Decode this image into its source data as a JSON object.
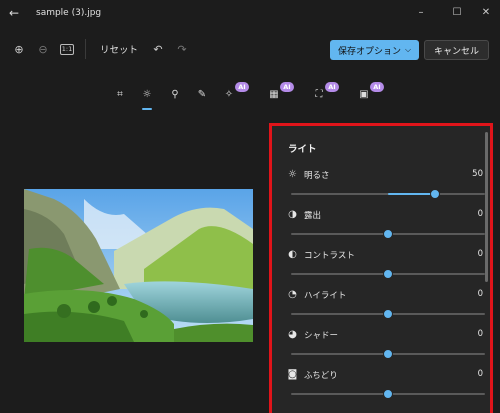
{
  "window": {
    "title": "sample (3).jpg",
    "back_icon": "←",
    "minimize_icon": "–",
    "maximize_icon": "☐",
    "close_icon": "✕"
  },
  "toolbar": {
    "zoom_in_icon": "⊕",
    "zoom_out_icon": "⊖",
    "actual_size_icon": "1:1",
    "reset_label": "リセット",
    "undo_icon": "↶",
    "redo_icon": "↷"
  },
  "actions": {
    "save_label": "保存オプション",
    "save_chevron": "⌵",
    "cancel_label": "キャンセル",
    "accent_color": "#62b6f0"
  },
  "tools": {
    "ai_badge": "AI",
    "items": [
      {
        "name": "crop-icon",
        "glyph": "⌗"
      },
      {
        "name": "adjust-icon",
        "glyph": "☼"
      },
      {
        "name": "filter-icon",
        "glyph": "⚲"
      },
      {
        "name": "markup-icon",
        "glyph": "✎"
      },
      {
        "name": "erase-icon",
        "glyph": "✧"
      },
      {
        "name": "blur-background-icon",
        "glyph": "▦"
      },
      {
        "name": "remove-background-icon",
        "glyph": "⛶"
      },
      {
        "name": "replace-background-icon",
        "glyph": "▣"
      }
    ]
  },
  "panel": {
    "title": "ライト",
    "sliders": [
      {
        "label": "明るさ",
        "icon": "☼",
        "value": "50",
        "position": 0.74
      },
      {
        "label": "露出",
        "icon": "◑",
        "value": "0",
        "position": 0.5
      },
      {
        "label": "コントラスト",
        "icon": "◐",
        "value": "0",
        "position": 0.5
      },
      {
        "label": "ハイライト",
        "icon": "◔",
        "value": "0",
        "position": 0.5
      },
      {
        "label": "シャドー",
        "icon": "◕",
        "value": "0",
        "position": 0.5
      },
      {
        "label": "ふちどり",
        "icon": "◙",
        "value": "0",
        "position": 0.5
      }
    ]
  }
}
